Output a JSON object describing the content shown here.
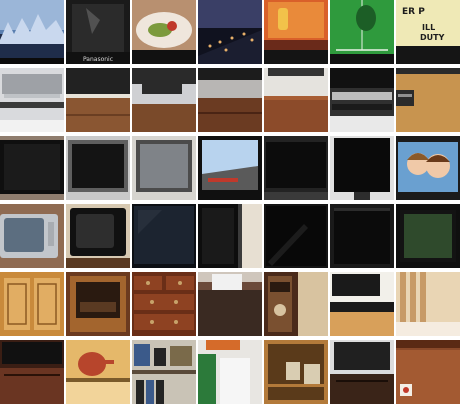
{
  "gallery": {
    "rows": 6,
    "columns": 7,
    "tiles": [
      {
        "name": "tile-r1c1",
        "subject": "tv-screen-city-scene",
        "colors": {
          "bg": "#5a7fb0",
          "a": "#c9d8ee",
          "b": "#1f2d4a"
        }
      },
      {
        "name": "tile-r1c2",
        "subject": "tv-dark-panel",
        "colors": {
          "bg": "#1a1a1a",
          "a": "#6b6b6b",
          "b": "#d8d8d8"
        },
        "brand": "Panasonic"
      },
      {
        "name": "tile-r1c3",
        "subject": "tv-screen-food-plate",
        "colors": {
          "bg": "#b89070",
          "a": "#efe6dc",
          "b": "#7c9a3d"
        }
      },
      {
        "name": "tile-r1c4",
        "subject": "tv-screen-city-lights",
        "colors": {
          "bg": "#10121f",
          "a": "#e8b06a",
          "b": "#3a3f66"
        }
      },
      {
        "name": "tile-r1c5",
        "subject": "tv-screen-orange-room",
        "colors": {
          "bg": "#d9602a",
          "a": "#f2c24a",
          "b": "#6a2a1a"
        }
      },
      {
        "name": "tile-r1c6",
        "subject": "tv-screen-tennis-court",
        "colors": {
          "bg": "#2f9a3d",
          "a": "#e9f1e6",
          "b": "#1c5e26"
        }
      },
      {
        "name": "tile-r1c7",
        "subject": "tv-screen-text-news",
        "colors": {
          "bg": "#efe9b6",
          "a": "#1d1d1d",
          "b": "#c7c08a"
        },
        "screen_text": [
          "ER P",
          "ILL",
          "DUTY"
        ]
      },
      {
        "name": "tile-r2c1",
        "subject": "tv-silver-on-stand",
        "colors": {
          "bg": "#d9dadd",
          "a": "#9ea1a6",
          "b": "#3a3a3a"
        }
      },
      {
        "name": "tile-r2c2",
        "subject": "tv-on-wood-cabinet",
        "colors": {
          "bg": "#e7e2d8",
          "a": "#8a5632",
          "b": "#222222"
        }
      },
      {
        "name": "tile-r2c3",
        "subject": "tv-base-on-cabinet",
        "colors": {
          "bg": "#cfd0d3",
          "a": "#7a4a2a",
          "b": "#2a2a2a"
        }
      },
      {
        "name": "tile-r2c4",
        "subject": "tv-stand-dark-wood",
        "colors": {
          "bg": "#b8b6b4",
          "a": "#6b3b22",
          "b": "#1c1c1c"
        }
      },
      {
        "name": "tile-r2c5",
        "subject": "tv-on-brown-table",
        "colors": {
          "bg": "#e5e3de",
          "a": "#8c4b2a",
          "b": "#333333"
        }
      },
      {
        "name": "tile-r2c6",
        "subject": "dvd-player-under-tv",
        "colors": {
          "bg": "#303030",
          "a": "#bdbdbd",
          "b": "#111111"
        }
      },
      {
        "name": "tile-r2c7",
        "subject": "tv-on-light-wood-unit",
        "colors": {
          "bg": "#f1ead8",
          "a": "#c8944f",
          "b": "#2b2b2b"
        }
      },
      {
        "name": "tile-r3c1",
        "subject": "black-tv-off",
        "colors": {
          "bg": "#8f7d6e",
          "a": "#0f0f0f",
          "b": "#2a2a2a"
        }
      },
      {
        "name": "tile-r3c2",
        "subject": "black-tv-silver-frame",
        "colors": {
          "bg": "#c9c9c9",
          "a": "#141414",
          "b": "#5f5f5f"
        }
      },
      {
        "name": "tile-r3c3",
        "subject": "grey-tv-off",
        "colors": {
          "bg": "#d6d4cf",
          "a": "#7f8388",
          "b": "#4b4b4b"
        }
      },
      {
        "name": "tile-r3c4",
        "subject": "tv-screen-road-scene",
        "colors": {
          "bg": "#101010",
          "a": "#b8d3ee",
          "b": "#5a5a5a"
        }
      },
      {
        "name": "tile-r3c5",
        "subject": "black-tv-dark-room",
        "colors": {
          "bg": "#232323",
          "a": "#0c0c0c",
          "b": "#3a3a3a"
        }
      },
      {
        "name": "tile-r3c6",
        "subject": "black-tv-on-stand",
        "colors": {
          "bg": "#e0e0e0",
          "a": "#0a0a0a",
          "b": "#2d2d2d"
        }
      },
      {
        "name": "tile-r3c7",
        "subject": "tv-screen-two-children",
        "colors": {
          "bg": "#1b1b1b",
          "a": "#f0c9a8",
          "b": "#6aa0d0"
        }
      },
      {
        "name": "tile-r4c1",
        "subject": "crt-tv-silver",
        "colors": {
          "bg": "#8f6b52",
          "a": "#c2c6cb",
          "b": "#5c6e80"
        }
      },
      {
        "name": "tile-r4c2",
        "subject": "crt-tv-black",
        "colors": {
          "bg": "#d7c9b2",
          "a": "#111111",
          "b": "#2e2e2e"
        }
      },
      {
        "name": "tile-r4c3",
        "subject": "dark-tv-closeup",
        "colors": {
          "bg": "#0c0f14",
          "a": "#1c2430",
          "b": "#2c3440"
        }
      },
      {
        "name": "tile-r4c4",
        "subject": "tv-next-to-wall",
        "colors": {
          "bg": "#e7dfd2",
          "a": "#0d0d0d",
          "b": "#3b3b3b"
        }
      },
      {
        "name": "tile-r4c5",
        "subject": "black-tv-glossy",
        "colors": {
          "bg": "#141414",
          "a": "#080808",
          "b": "#2a2a2a"
        }
      },
      {
        "name": "tile-r4c6",
        "subject": "black-tv-dim",
        "colors": {
          "bg": "#1a1a1a",
          "a": "#0b0b0b",
          "b": "#2c2c2c"
        }
      },
      {
        "name": "tile-r4c7",
        "subject": "tv-green-screen",
        "colors": {
          "bg": "#0f0f0f",
          "a": "#2f4a2c",
          "b": "#131313"
        }
      },
      {
        "name": "tile-r5c1",
        "subject": "wooden-cabinet-doors",
        "colors": {
          "bg": "#c98a3b",
          "a": "#e1ad63",
          "b": "#8c5a22"
        }
      },
      {
        "name": "tile-r5c2",
        "subject": "fireplace-cabinet",
        "colors": {
          "bg": "#6b3a1f",
          "a": "#2a1a10",
          "b": "#a3652e"
        }
      },
      {
        "name": "tile-r5c3",
        "subject": "wood-dresser-drawers",
        "colors": {
          "bg": "#6a2e17",
          "a": "#8e4222",
          "b": "#c7a26a"
        }
      },
      {
        "name": "tile-r5c4",
        "subject": "tissue-box-on-cabinet",
        "colors": {
          "bg": "#6b4a3a",
          "a": "#f1f1f1",
          "b": "#3a2a22"
        }
      },
      {
        "name": "tile-r5c5",
        "subject": "shelf-with-vase",
        "colors": {
          "bg": "#4a2a1a",
          "a": "#d8c3a0",
          "b": "#7a5030"
        }
      },
      {
        "name": "tile-r5c6",
        "subject": "tv-on-low-stand",
        "colors": {
          "bg": "#f2f0ea",
          "a": "#1a1a1a",
          "b": "#d8a05a"
        }
      },
      {
        "name": "tile-r5c7",
        "subject": "wood-panel-wall",
        "colors": {
          "bg": "#e9d5b4",
          "a": "#c79a66",
          "b": "#f5ece0"
        }
      },
      {
        "name": "tile-r6c1",
        "subject": "tv-on-wood-console",
        "colors": {
          "bg": "#3a1e14",
          "a": "#111111",
          "b": "#6a3522"
        }
      },
      {
        "name": "tile-r6c2",
        "subject": "teapot-on-shelf",
        "colors": {
          "bg": "#e5b86a",
          "a": "#b7452c",
          "b": "#7a5a2a"
        }
      },
      {
        "name": "tile-r6c3",
        "subject": "cluttered-shelf",
        "colors": {
          "bg": "#c9c3b6",
          "a": "#3b5a8a",
          "b": "#242424"
        }
      },
      {
        "name": "tile-r6c4",
        "subject": "book-and-sign",
        "colors": {
          "bg": "#e8e6e2",
          "a": "#2c7a3a",
          "b": "#d56b2a"
        }
      },
      {
        "name": "tile-r6c5",
        "subject": "bookshelf-with-photos",
        "colors": {
          "bg": "#b37a3a",
          "a": "#d9cdb2",
          "b": "#5a3a1a"
        }
      },
      {
        "name": "tile-r6c6",
        "subject": "tv-on-dark-stand",
        "colors": {
          "bg": "#dcdcdc",
          "a": "#202020",
          "b": "#3a2418"
        }
      },
      {
        "name": "tile-r6c7",
        "subject": "wood-cabinet-with-label",
        "colors": {
          "bg": "#8a4a2a",
          "a": "#f3efe6",
          "b": "#c23a2a"
        }
      }
    ]
  }
}
